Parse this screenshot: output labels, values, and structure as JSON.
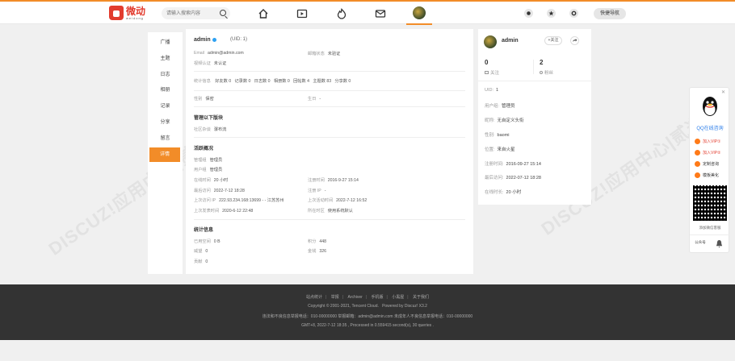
{
  "header": {
    "logo_cn": "微动",
    "logo_en": "weidong",
    "search_placeholder": "请输入搜索内容",
    "quick_nav_label": "快捷导航"
  },
  "left_nav": {
    "items": [
      "广播",
      "主题",
      "日志",
      "相册",
      "记录",
      "分享",
      "留言",
      "详情"
    ],
    "active_index": 7
  },
  "profile": {
    "username": "admin",
    "uid": "(UID: 1)",
    "email_label": "Email",
    "email_value": "admin@admin.com",
    "mail_status_label": "邮箱状态",
    "mail_status_value": "未验证",
    "video_label": "视频认证",
    "video_value": "未认证",
    "stats_label": "统计信息",
    "stats": [
      "好友数 0",
      "记录数 0",
      "日志数 0",
      "相册数 0",
      "回帖数 4",
      "主题数 83",
      "分享数 0"
    ],
    "gender_label": "性别",
    "gender_value": "保密",
    "birthday_label": "生日",
    "birthday_value": "-",
    "manage_title": "管理以下版块",
    "manage_label": "社区杂谈",
    "manage_value": "瀑布流",
    "activity_title": "活跃概况",
    "admin_group_label": "管理组",
    "admin_group_value": "管理员",
    "user_group_label": "用户组",
    "user_group_value": "管理员",
    "online_label": "在线时间",
    "online_value": "20 小时",
    "register_label": "注册时间",
    "register_value": "2016-9-27 15:14",
    "last_visit_label": "最后访问",
    "last_visit_value": "2022-7-12 18:28",
    "register_ip_label": "注册 IP",
    "register_ip_value": "-",
    "last_ip_label": "上次访问 IP",
    "last_ip_value": "222.93.234.168:13699 - - 江苏苏州",
    "last_active_label": "上次活动时间",
    "last_active_value": "2022-7-12 16:52",
    "last_post_label": "上次发表时间",
    "last_post_value": "2020-6-12 22:48",
    "timezone_label": "所在时区",
    "timezone_value": "使用系统默认",
    "statistics_title": "统计信息",
    "space_label": "已用空间",
    "space_value": "0 B",
    "points_label": "积分",
    "points_value": "448",
    "prestige_label": "威望",
    "prestige_value": "0",
    "gold_label": "金钱",
    "gold_value": "326",
    "contrib_label": "贡献",
    "contrib_value": "0"
  },
  "side_card": {
    "username": "admin",
    "follow_label": "+关注",
    "following_count": "0",
    "following_label": "关注",
    "fans_count": "2",
    "fans_label": "粉丝",
    "rows": [
      {
        "k": "UID",
        "v": "1"
      },
      {
        "k": "用户组",
        "v": "管理员"
      },
      {
        "k": "昵称",
        "v": "无自定义头衔"
      },
      {
        "k": "性别",
        "v": "baomi"
      },
      {
        "k": "位置",
        "v": "来自火星"
      },
      {
        "k": "注册时间",
        "v": "2016-09-27 15:14"
      },
      {
        "k": "最后访问",
        "v": "2022-07-12 18:28"
      },
      {
        "k": "在线时长",
        "v": "20 小时"
      }
    ]
  },
  "float_panel": {
    "qq_label": "QQ在线咨询",
    "items": [
      "加入VIP①",
      "加入VIP②",
      "定制咨询",
      "模板美化"
    ],
    "qr_label": "添加微信客服",
    "bottom_left": "公众号"
  },
  "footer": {
    "links": [
      "站点统计",
      "举报",
      "Archiver",
      "手机版",
      "小黑屋",
      "关于我们"
    ],
    "copyright": "Copyright © 2001-2021, Tencent Cloud.",
    "powered": "Powered by Discuz! X3.2",
    "contact": "违法和不良信息举报电话：010-00000000 举报邮箱：admin@admin.com 未成年人不良信息举报电话：010-00000000",
    "gmt": "GMT+8, 2022-7-12 18:35 , Processed in 0.559415 second(s), 30 queries ."
  },
  "watermark": "DISCUZ!应用中心|贰道"
}
